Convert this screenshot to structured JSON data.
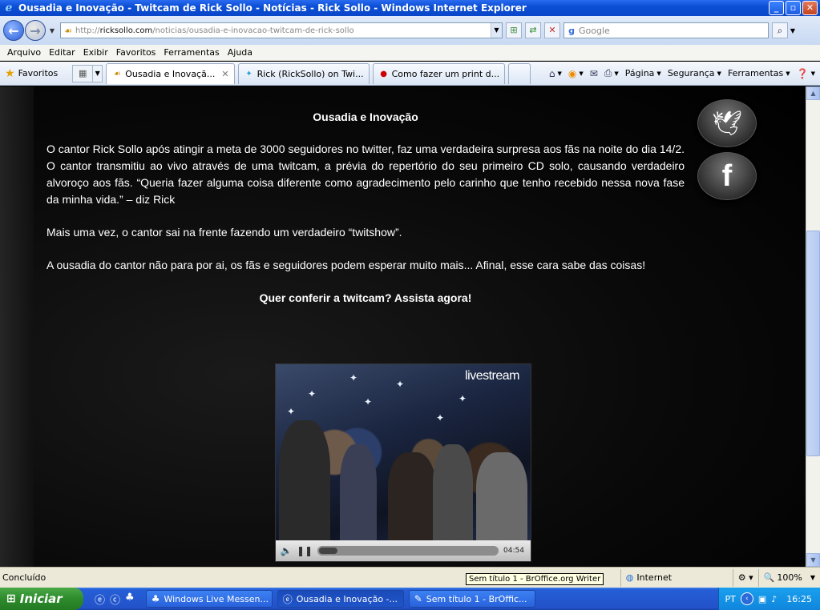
{
  "window": {
    "title": "Ousadia e Inovação - Twitcam de Rick Sollo - Notícias - Rick Sollo - Windows Internet Explorer",
    "min_glyph": "_",
    "max_glyph": "▫",
    "close_glyph": "✕"
  },
  "address": {
    "url_prefix": "http://",
    "url_host": "ricksollo.com",
    "url_path": "/noticias/ousadia-e-inovacao-twitcam-de-rick-sollo",
    "search_placeholder": "Google"
  },
  "menu": [
    "Arquivo",
    "Editar",
    "Exibir",
    "Favoritos",
    "Ferramentas",
    "Ajuda"
  ],
  "favorites_label": "Favoritos",
  "tabs": [
    {
      "label": "Ousadia e Inovaçã...",
      "icon": "ricksollo-icon",
      "active": true
    },
    {
      "label": "Rick (RickSollo) on Twi...",
      "icon": "twitter-icon",
      "active": false
    },
    {
      "label": "Como fazer um print d...",
      "icon": "youtube-icon",
      "active": false
    }
  ],
  "commandbar": {
    "page": "Página",
    "security": "Segurança",
    "tools": "Ferramentas"
  },
  "article": {
    "title": "Ousadia e Inovação",
    "paragraphs": [
      "O cantor Rick Sollo após atingir a meta de 3000 seguidores no twitter, faz uma verdadeira surpresa aos fãs na noite do dia 14/2. O cantor transmitiu ao vivo através de uma twitcam, a prévia do repertório do seu primeiro CD solo, causando verdadeiro alvoroço aos fãs. “Queria fazer alguma coisa diferente como agradecimento pelo carinho que tenho recebido nessa nova fase da minha vida.” – diz Rick",
      "Mais uma vez, o cantor sai na frente fazendo um verdadeiro “twitshow”.",
      "A ousadia do cantor não para por ai, os fãs e seguidores podem esperar muito mais... Afinal, esse cara sabe das coisas!"
    ],
    "cta": "Quer conferir a twitcam? Assista agora!"
  },
  "player": {
    "brand": "livestream",
    "time": "04:54",
    "progress": 0.1
  },
  "status": {
    "text": "Concluído",
    "zone": "Internet",
    "zoom": "100%"
  },
  "tooltip": "Sem título 1 - BrOffice.org Writer",
  "taskbar": {
    "start": "Iniciar",
    "tasks": [
      {
        "label": "Windows Live Messen...",
        "active": false
      },
      {
        "label": "Ousadia e Inovação -...",
        "active": true
      },
      {
        "label": "Sem título 1 - BrOffic...",
        "active": false
      }
    ],
    "lang": "PT",
    "clock": "16:25"
  },
  "colors": {
    "titlebar": "#0b4fd6",
    "page_bg": "#000000",
    "article_text": "#ffffff"
  }
}
